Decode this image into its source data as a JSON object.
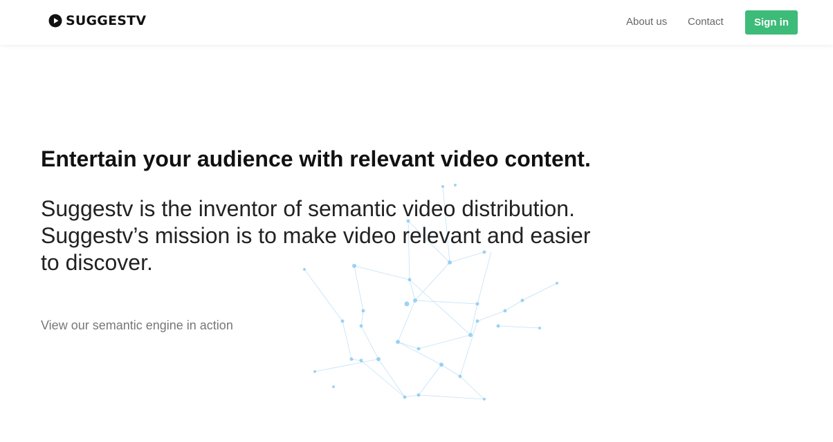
{
  "header": {
    "logo_text": "SUGGESTV",
    "logo_icon": "play-circle-icon",
    "nav": {
      "about": "About us",
      "contact": "Contact"
    },
    "signin_label": "Sign in"
  },
  "hero": {
    "headline": "Entertain your audience with relevant video content.",
    "lead": "Suggestv is the inventor of semantic video distribution. Suggestv’s mission is to make video relevant and easier to discover.",
    "demo_link": "View our semantic engine in action"
  },
  "colors": {
    "accent": "#3dbb78",
    "network": "#7cc4f0"
  }
}
